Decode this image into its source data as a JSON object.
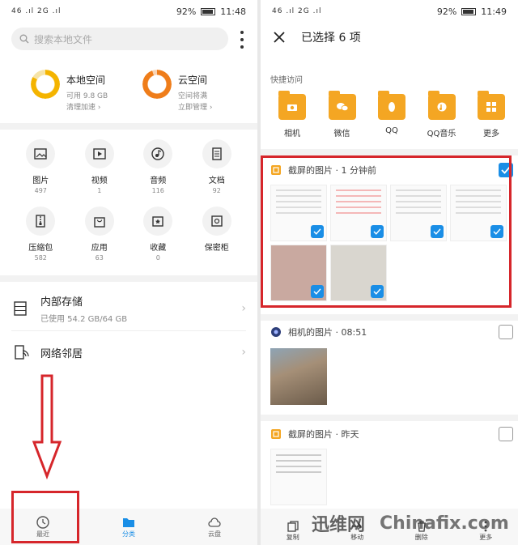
{
  "left": {
    "status": {
      "signal": "46 .ıl 2G .ıl",
      "battery": "92%",
      "time": "11:48"
    },
    "search_placeholder": "搜索本地文件",
    "storage": [
      {
        "title": "本地空间",
        "line1": "可用 9.8 GB",
        "line2": "清理加速 ›",
        "color": "#f4b400"
      },
      {
        "title": "云空间",
        "line1": "空间将满",
        "line2": "立即管理 ›",
        "color": "#ef7d1a"
      }
    ],
    "categories": [
      {
        "label": "图片",
        "count": "497"
      },
      {
        "label": "视频",
        "count": "1"
      },
      {
        "label": "音频",
        "count": "116"
      },
      {
        "label": "文档",
        "count": "92"
      },
      {
        "label": "压缩包",
        "count": "582"
      },
      {
        "label": "应用",
        "count": "63"
      },
      {
        "label": "收藏",
        "count": "0"
      },
      {
        "label": "保密柜",
        "count": ""
      }
    ],
    "internal": {
      "title": "内部存储",
      "sub": "已使用 54.2 GB/64 GB"
    },
    "network": {
      "title": "网络邻居"
    },
    "nav": [
      {
        "label": "最近"
      },
      {
        "label": "分类"
      },
      {
        "label": "云盘"
      }
    ]
  },
  "right": {
    "status": {
      "signal": "46 .ıl 2G .ıl",
      "battery": "92%",
      "time": "11:49"
    },
    "title": "已选择 6 项",
    "quick_title": "快捷访问",
    "quick": [
      {
        "label": "相机"
      },
      {
        "label": "微信"
      },
      {
        "label": "QQ"
      },
      {
        "label": "QQ音乐"
      },
      {
        "label": "更多"
      }
    ],
    "groups": [
      {
        "title": "截屏的图片 · 1 分钟前"
      },
      {
        "title": "相机的图片 · 08:51"
      },
      {
        "title": "截屏的图片 · 昨天"
      }
    ],
    "actions": [
      {
        "label": "复制"
      },
      {
        "label": "移动"
      },
      {
        "label": "删除"
      },
      {
        "label": "更多"
      }
    ]
  },
  "watermark": {
    "left": "迅维网",
    "right": "Chinafix.com"
  },
  "colors": {
    "accent": "#1a8ee6",
    "highlight": "#d6262b",
    "folder": "#f4a623"
  }
}
